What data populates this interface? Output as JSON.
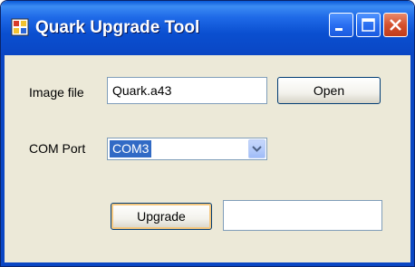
{
  "window": {
    "title": "Quark Upgrade Tool",
    "controls": {
      "minimize_icon": "minimize-icon",
      "maximize_icon": "maximize-icon",
      "close_icon": "close-icon"
    }
  },
  "form": {
    "image_file": {
      "label": "Image file",
      "value": "Quark.a43",
      "open_button_label": "Open"
    },
    "com_port": {
      "label": "COM Port",
      "selected": "COM3"
    },
    "upgrade": {
      "button_label": "Upgrade",
      "status_value": ""
    }
  },
  "colors": {
    "titlebar": "#0a46c4",
    "selection": "#316ac5",
    "dialog_background": "#ece9d8"
  }
}
